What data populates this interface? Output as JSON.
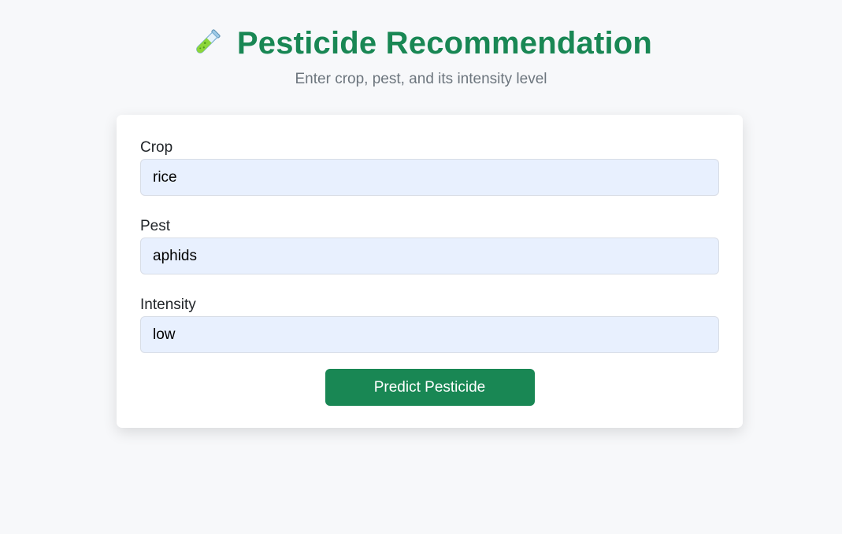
{
  "header": {
    "icon": "test-tube-icon",
    "title": "Pesticide Recommendation",
    "subtitle": "Enter crop, pest, and its intensity level"
  },
  "form": {
    "fields": [
      {
        "label": "Crop",
        "value": "rice"
      },
      {
        "label": "Pest",
        "value": "aphids"
      },
      {
        "label": "Intensity",
        "value": "low"
      }
    ],
    "submit_label": "Predict Pesticide"
  },
  "colors": {
    "brand": "#198754",
    "input_bg": "#e8f0fe",
    "page_bg": "#f7f8fa"
  }
}
